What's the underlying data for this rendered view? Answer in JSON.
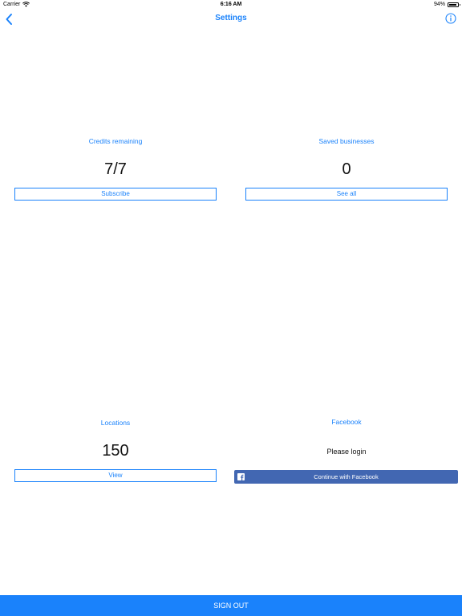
{
  "status_bar": {
    "carrier": "Carrier",
    "time": "6:16 AM",
    "battery": "94%",
    "battery_level": 0.94,
    "wifi_icon": "wifi-icon",
    "battery_icon": "battery-icon"
  },
  "nav": {
    "title": "Settings",
    "back_icon": "chevron-left-icon",
    "info_icon": "info-circle-icon"
  },
  "credits": {
    "label": "Credits remaining",
    "value": "7/7",
    "button": "Subscribe"
  },
  "saved": {
    "label": "Saved businesses",
    "value": "0",
    "button": "See all"
  },
  "locations": {
    "label": "Locations",
    "value": "150",
    "button": "View"
  },
  "facebook": {
    "label": "Facebook",
    "status": "Please login",
    "button": "Continue with Facebook",
    "icon": "facebook-logo-icon"
  },
  "sign_out": {
    "label": "SIGN OUT"
  },
  "colors": {
    "accent": "#1a82fb",
    "facebook": "#4267b2",
    "background": "#ffffff",
    "text": "#111111"
  }
}
